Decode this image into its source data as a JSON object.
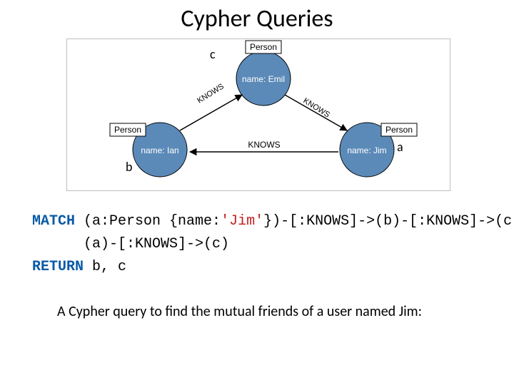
{
  "title": "Cypher Queries",
  "diagram": {
    "node_type_label": "Person",
    "nodes": {
      "emil": {
        "prop": "name: Emil",
        "var": "c"
      },
      "ian": {
        "prop": "name: Ian",
        "var": "b"
      },
      "jim": {
        "prop": "name: Jim",
        "var": "a"
      }
    },
    "edge_label": "KNOWS"
  },
  "query": {
    "kw_match": "MATCH",
    "line1_rest": " (a:Person {name:",
    "str_jim": "'Jim'",
    "line1_tail": "})-[:KNOWS]->(b)-[:KNOWS]->(c),",
    "line2": "      (a)-[:KNOWS]->(c)",
    "kw_return": "RETURN",
    "line3_rest": " b, c"
  },
  "caption": "A Cypher query  to find the mutual friends of a user named Jim:"
}
